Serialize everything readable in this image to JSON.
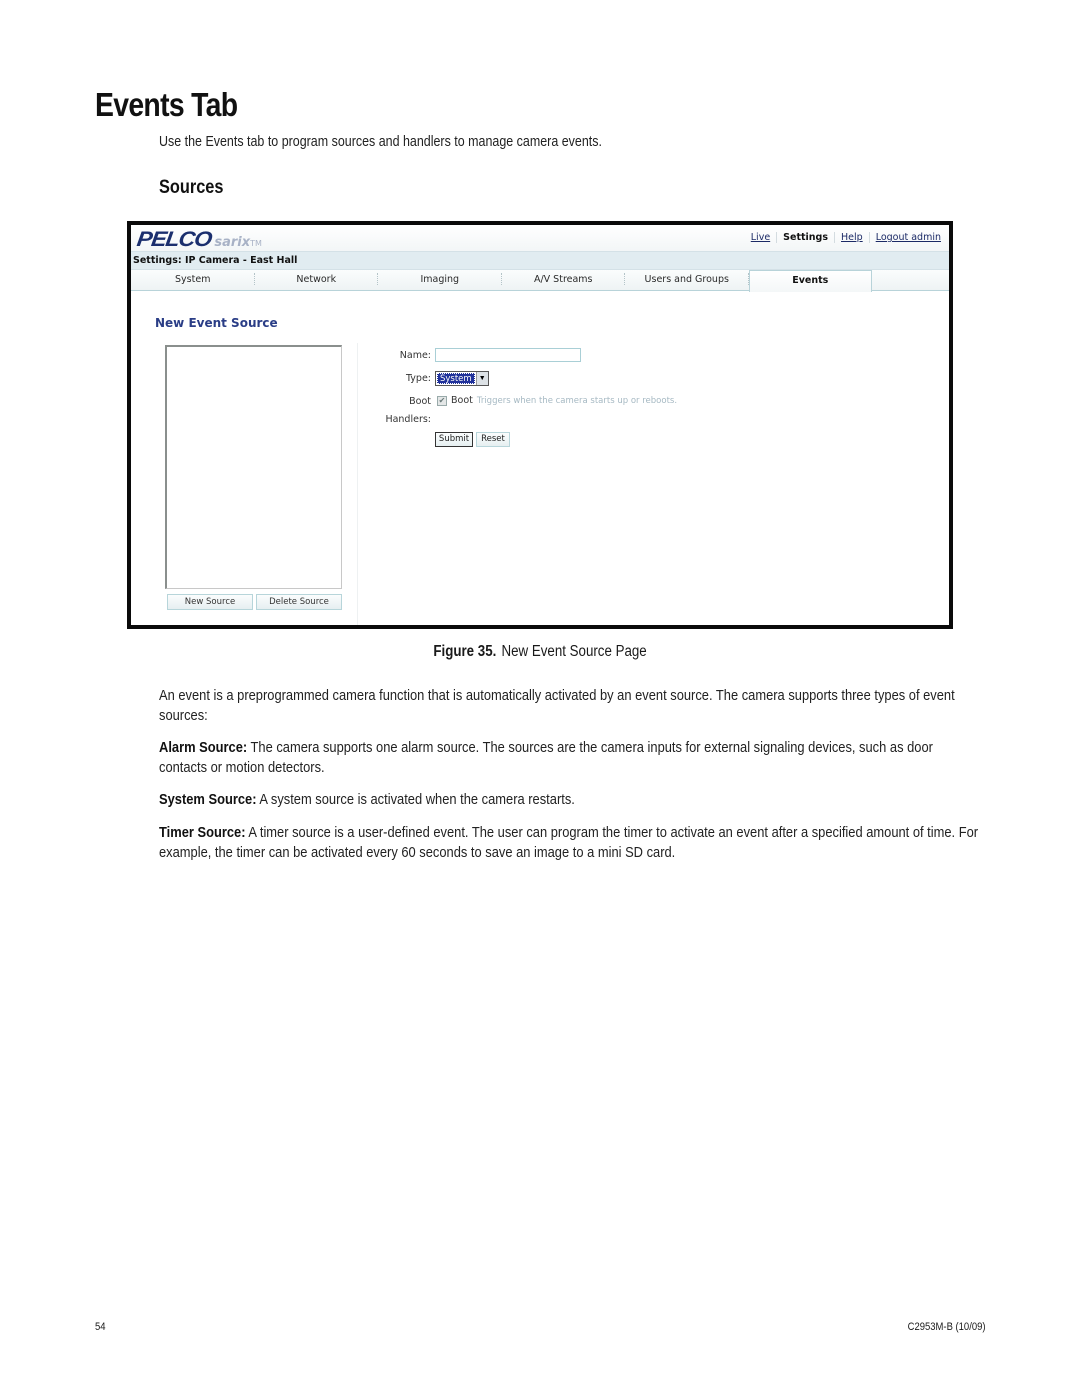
{
  "document": {
    "title": "Events Tab",
    "intro": "Use the Events tab to program sources and handlers to manage camera events.",
    "section_heading": "Sources"
  },
  "app": {
    "logo": {
      "brand": "PELCO",
      "product": "sarix",
      "trademark": "TM"
    },
    "top_links": {
      "live": "Live",
      "settings": "Settings",
      "help": "Help",
      "logout": "Logout admin"
    },
    "settings_bar": "Settings: IP Camera - East Hall",
    "tabs": [
      {
        "label": "System",
        "active": false
      },
      {
        "label": "Network",
        "active": false
      },
      {
        "label": "Imaging",
        "active": false
      },
      {
        "label": "A/V Streams",
        "active": false
      },
      {
        "label": "Users and Groups",
        "active": false
      },
      {
        "label": "Events",
        "active": true
      }
    ],
    "content_title": "New Event Source",
    "source_list": {
      "items": []
    },
    "buttons": {
      "new_source": "New Source",
      "delete_source": "Delete Source"
    },
    "form": {
      "name_label": "Name:",
      "name_value": "",
      "type_label": "Type:",
      "type_value": "System",
      "boot_label": "Boot",
      "boot_checkbox_label": "Boot",
      "boot_checked": true,
      "boot_description": "Triggers when the camera starts up or reboots.",
      "handlers_label": "Handlers:",
      "submit": "Submit",
      "reset": "Reset"
    },
    "colors": {
      "accent": "#2a3d86",
      "logo": "#1b2f6e",
      "bar": "#e1ecf1",
      "selection": "#20319a"
    }
  },
  "caption": {
    "figure": "Figure 35.",
    "text": "New Event Source Page"
  },
  "paragraphs": {
    "event_intro": "An event is a preprogrammed camera function that is automatically activated by an event source. The camera supports three types of event sources:",
    "alarm": {
      "term": "Alarm Source:",
      "text": " The camera supports one alarm source. The sources are the camera inputs for external signaling devices, such as door contacts or motion detectors."
    },
    "system": {
      "term": "System Source:",
      "text": " A system source is activated when the camera restarts."
    },
    "timer": {
      "term": "Timer Source:",
      "text": " A timer source is a user-defined event. The user can program the timer to activate an event after a specified amount of time. For example, the timer can be activated every 60 seconds to save an image to a mini SD card."
    }
  },
  "footer": {
    "page_number": "54",
    "doc_id": "C2953M-B (10/09)"
  }
}
